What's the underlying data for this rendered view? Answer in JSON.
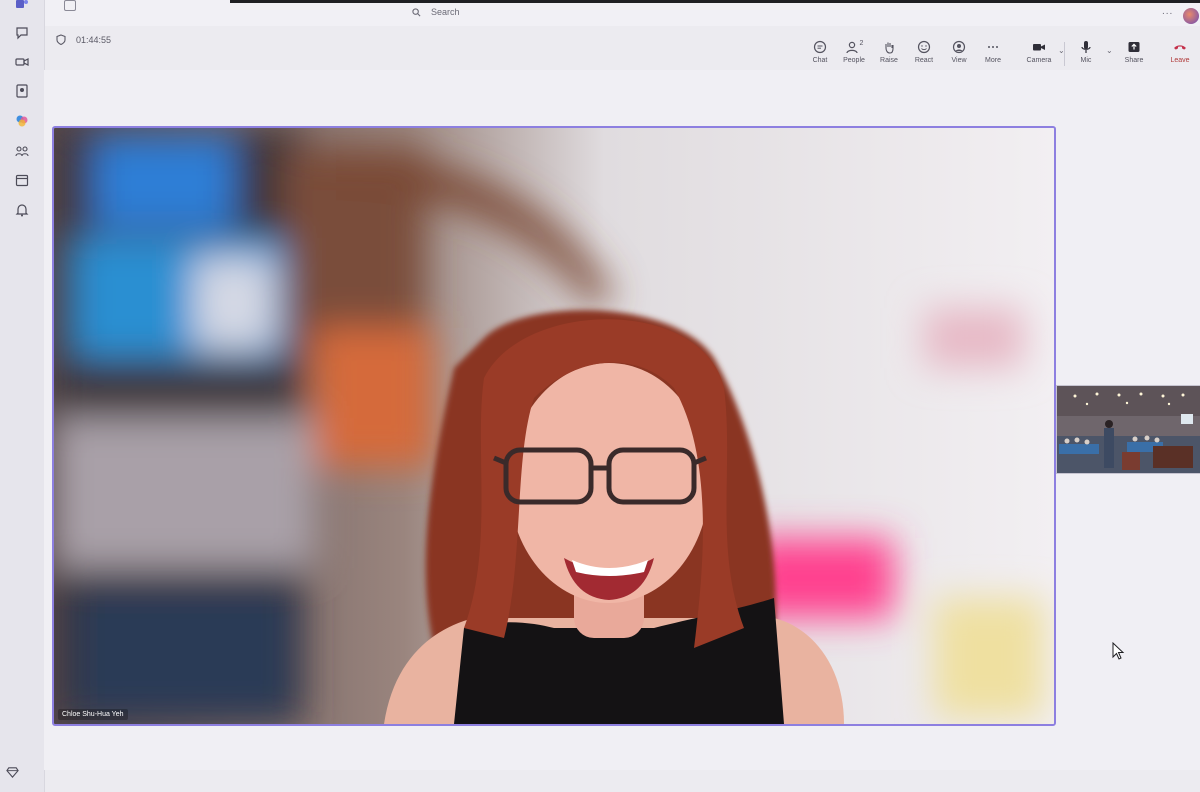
{
  "header": {
    "search_label": "Search",
    "more_label": "..."
  },
  "meeting": {
    "timer": "01:44:55"
  },
  "controls": {
    "chat": "Chat",
    "people": "People",
    "people_count": "2",
    "raise": "Raise",
    "react": "React",
    "view": "View",
    "more": "More",
    "camera": "Camera",
    "mic": "Mic",
    "share": "Share",
    "leave": "Leave"
  },
  "participants": {
    "main_name": "Chloe Shu-Hua Yeh"
  },
  "colors": {
    "active_border": "#8d7fe0",
    "leave": "#c4314b"
  },
  "rail_icons": [
    "teams-icon",
    "chat-icon",
    "video-icon",
    "contacts-icon",
    "copilot-icon",
    "people-icon",
    "calendar-icon",
    "bell-icon",
    "gem-icon"
  ]
}
